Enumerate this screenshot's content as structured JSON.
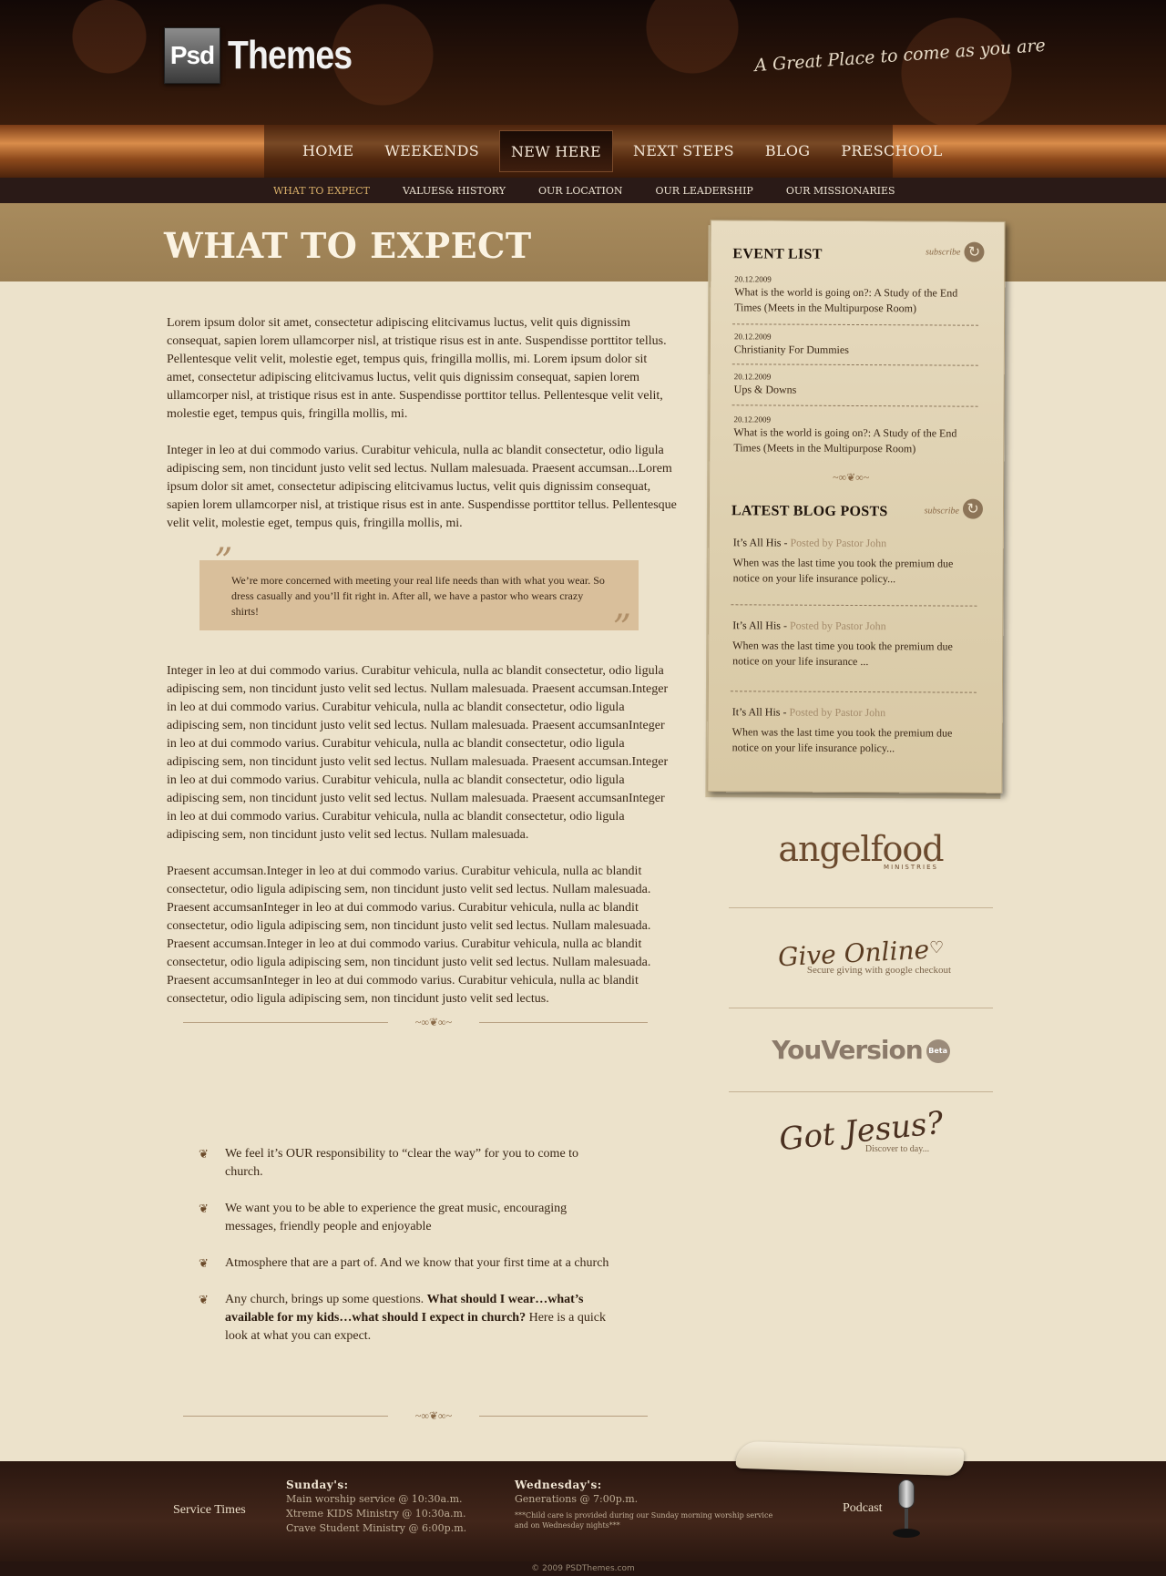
{
  "header": {
    "logo_box": "Psd",
    "logo_word": "Themes",
    "tagline": "A Great Place to come as you are"
  },
  "main_nav": [
    "HOME",
    "WEEKENDS",
    "NEW HERE",
    "NEXT STEPS",
    "BLOG",
    "PRESCHOOL"
  ],
  "main_nav_active": "NEW HERE",
  "sub_nav": [
    "WHAT TO EXPECT",
    "VALUES& HISTORY",
    "OUR LOCATION",
    "OUR LEADERSHIP",
    "OUR MISSIONARIES"
  ],
  "sub_nav_active": "WHAT TO EXPECT",
  "page_title": "WHAT TO EXPECT",
  "content": {
    "p1": "Lorem ipsum dolor sit amet, consectetur adipiscing elitcivamus luctus, velit quis dignissim consequat, sapien lorem ullamcorper nisl, at tristique risus est in ante. Suspendisse porttitor tellus. Pellentesque velit velit, molestie eget, tempus quis, fringilla mollis, mi. Lorem ipsum dolor sit amet, consectetur adipiscing elitcivamus luctus, velit quis dignissim consequat, sapien lorem ullamcorper nisl, at tristique risus est in ante. Suspendisse porttitor tellus. Pellentesque velit velit, molestie eget, tempus quis, fringilla mollis, mi.",
    "p2": "Integer in leo at dui commodo varius. Curabitur vehicula, nulla ac blandit consectetur, odio ligula adipiscing sem, non tincidunt justo velit sed lectus. Nullam malesuada. Praesent accumsan...Lorem ipsum dolor sit amet, consectetur adipiscing elitcivamus luctus, velit quis dignissim consequat, sapien lorem ullamcorper nisl, at tristique risus est in ante. Suspendisse porttitor tellus. Pellentesque velit velit, molestie eget, tempus quis, fringilla mollis, mi.",
    "quote": "We’re more concerned with meeting your real life needs than with what you wear.  So dress casually and you’ll fit right in.  After all, we have a pastor who wears crazy shirts!",
    "p3": "Integer in leo at dui commodo varius. Curabitur vehicula, nulla ac blandit consectetur, odio ligula adipiscing sem, non tincidunt justo velit sed lectus. Nullam malesuada. Praesent accumsan.Integer in leo at dui commodo varius. Curabitur vehicula, nulla ac blandit consectetur, odio ligula adipiscing sem, non tincidunt justo velit sed lectus. Nullam malesuada. Praesent accumsanInteger in leo at dui commodo varius. Curabitur vehicula, nulla ac blandit consectetur, odio ligula adipiscing sem, non tincidunt justo velit sed lectus. Nullam malesuada. Praesent accumsan.Integer in leo at dui commodo varius. Curabitur vehicula, nulla ac blandit consectetur, odio ligula adipiscing sem, non tincidunt justo velit sed lectus. Nullam malesuada. Praesent accumsanInteger in leo at dui commodo varius. Curabitur vehicula, nulla ac blandit consectetur, odio ligula adipiscing sem, non tincidunt justo velit sed lectus. Nullam malesuada.",
    "p4": "Praesent accumsan.Integer in leo at dui commodo varius. Curabitur vehicula, nulla ac blandit consectetur, odio ligula adipiscing sem, non tincidunt justo velit sed lectus. Nullam malesuada. Praesent accumsanInteger in leo at dui commodo varius. Curabitur vehicula, nulla ac blandit consectetur, odio ligula adipiscing sem, non tincidunt justo velit sed lectus. Nullam malesuada. Praesent accumsan.Integer in leo at dui commodo varius. Curabitur vehicula, nulla ac blandit consectetur, odio ligula adipiscing sem, non tincidunt justo velit sed lectus. Nullam malesuada. Praesent accumsanInteger in leo at dui commodo varius. Curabitur vehicula, nulla ac blandit consectetur, odio ligula adipiscing sem, non tincidunt justo velit sed lectus."
  },
  "bullets": [
    {
      "text": "We feel it’s OUR responsibility to “clear the way” for you to come to church.",
      "bold": ""
    },
    {
      "text": "We want you to be able to experience the great music, encouraging messages, friendly people and enjoyable",
      "bold": ""
    },
    {
      "text": "Atmosphere that are a part of.  And we know that your first time at a church",
      "bold": ""
    },
    {
      "text": "Any church, brings up some questions.  ",
      "bold": "What should I wear…what’s available for my kids…what should I expect in church?",
      "tail": "  Here is a quick look at what you can expect."
    }
  ],
  "sidebar": {
    "events_heading": "EVENT LIST",
    "subscribe": "subscribe",
    "events": [
      {
        "date": "20.12.2009",
        "title": "What is the world is going on?: A Study of the End Times (Meets in the Multipurpose Room)"
      },
      {
        "date": "20.12.2009",
        "title": "Christianity For Dummies"
      },
      {
        "date": "20.12.2009",
        "title": "Ups & Downs"
      },
      {
        "date": "20.12.2009",
        "title": "What is the world is going on?: A Study of the End Times (Meets in the Multipurpose Room)"
      }
    ],
    "blog_heading": "LATEST BLOG POSTS",
    "posts": [
      {
        "title": "It’s All His -",
        "by": " Posted by Pastor John",
        "excerpt": "When was the last time you took the premium due notice on your life insurance policy..."
      },
      {
        "title": "It’s All His -",
        "by": " Posted by Pastor John",
        "excerpt": "When was the last time you took the premium due notice on your life insurance ..."
      },
      {
        "title": "It’s All His -",
        "by": " Posted by Pastor John",
        "excerpt": "When was the last time you took the premium due notice on your life insurance policy..."
      }
    ]
  },
  "promos": {
    "angel_a": "angel",
    "angel_b": "food",
    "angel_min": "MINISTRIES",
    "give": "Give Online",
    "give_sub": "Secure giving with google checkout",
    "youversion": "YouVersion",
    "beta": "Beta",
    "got": "Got Jesus?",
    "got_sub": "Discover to day..."
  },
  "footer": {
    "service_times": "Service Times",
    "sunday_heading": "Sunday's:",
    "sunday_lines": [
      "Main worship service @ 10:30a.m.",
      "Xtreme KIDS Ministry @ 10:30a.m.",
      "Crave Student Ministry @ 6:00p.m."
    ],
    "wed_heading": "Wednesday's:",
    "wed_line": "Generations @ 7:00p.m.",
    "wed_note": "***Child care is provided during our Sunday morning worship service and on Wednesday nights***",
    "podcast": "Podcast",
    "copyright": "© 2009 PSDThemes.com"
  }
}
